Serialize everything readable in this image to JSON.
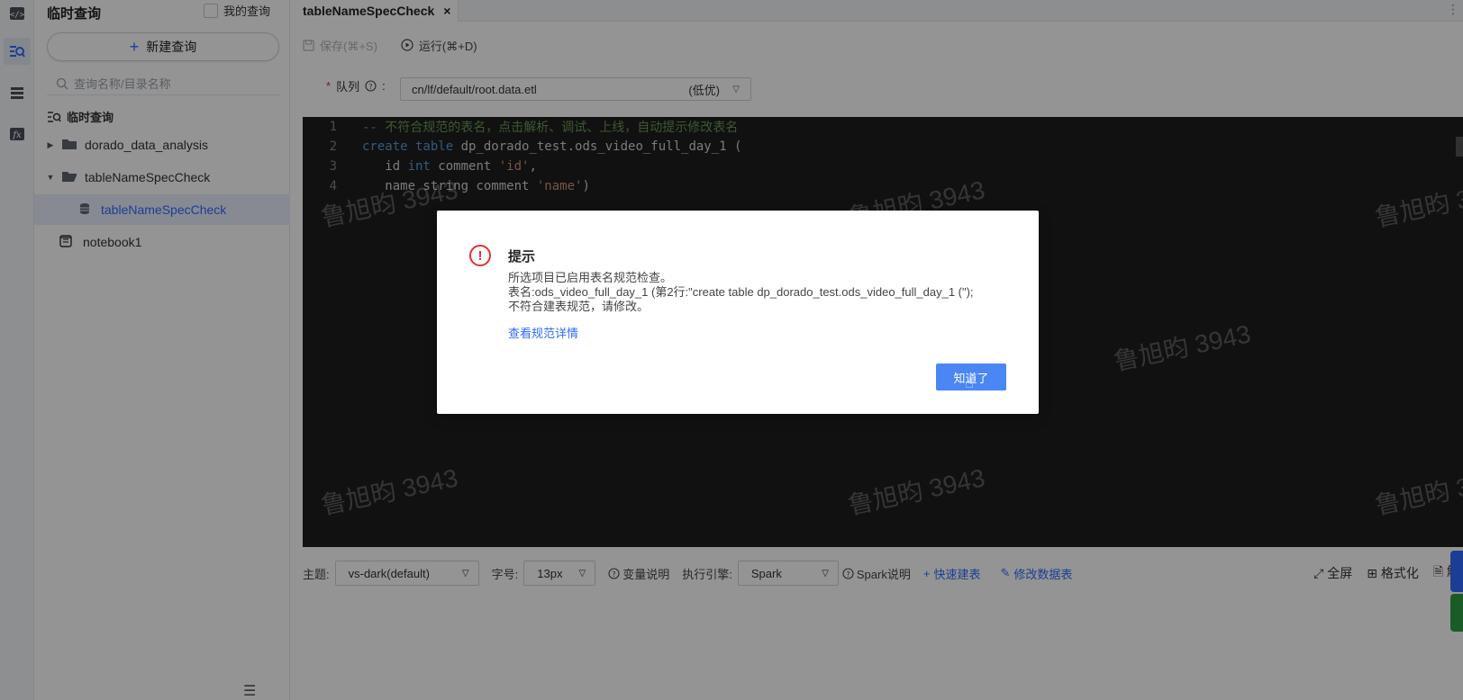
{
  "sidebar": {
    "title": "临时查询",
    "my_queries": "我的查询",
    "new_query": "新建查询",
    "search_placeholder": "查询名称/目录名称",
    "tree_root": "临时查询",
    "tree": [
      {
        "label": "dorado_data_analysis",
        "type": "folder",
        "expanded": false
      },
      {
        "label": "tableNameSpecCheck",
        "type": "folder",
        "expanded": true
      },
      {
        "label": "tableNameSpecCheck",
        "type": "query",
        "active": true
      },
      {
        "label": "notebook1",
        "type": "notebook"
      }
    ]
  },
  "tab": {
    "label": "tableNameSpecCheck",
    "close": "×"
  },
  "toolbar": {
    "save": "保存(⌘+S)",
    "run": "运行(⌘+D)"
  },
  "queue": {
    "label": "队列",
    "required": "*",
    "value": "cn/lf/default/root.data.etl",
    "priority": "(低优)"
  },
  "editor": {
    "lines": [
      {
        "n": "1",
        "comment": "-- 不符合规范的表名，点击解析、调试、上线，自动提示修改表名"
      },
      {
        "n": "2",
        "kw1": "create table ",
        "id1": "dp_dorado_test.ods_video_full_day_1 ("
      },
      {
        "n": "3",
        "id1": "   id ",
        "kw1": "int",
        "id2": " comment ",
        "str1": "'id'",
        "id3": ","
      },
      {
        "n": "4",
        "id1": "   name string comment ",
        "str1": "'name'",
        "id2": ")"
      }
    ]
  },
  "bottom": {
    "theme_label": "主题:",
    "theme_value": "vs-dark(default)",
    "font_label": "字号:",
    "font_value": "13px",
    "var_help": "变量说明",
    "engine_label": "执行引擎:",
    "engine_value": "Spark",
    "spark_help": "Spark说明",
    "quick_create": "快速建表",
    "modify_table": "修改数据表",
    "fullscreen": "全屏",
    "format": "格式化",
    "parse": "解"
  },
  "dialog": {
    "title": "提示",
    "line1": "所选项目已启用表名规范检查。",
    "line2": "表名:ods_video_full_day_1   (第2行:\"create table dp_dorado_test.ods_video_full_day_1 (\");",
    "line3": "不符合建表规范，请修改。",
    "link": "查看规范详情",
    "ok": "知道了"
  },
  "watermark": "鲁旭昀 3943",
  "colors": {
    "accent": "#2f6bff",
    "error": "#e03131",
    "editor_bg": "#1e1e1e"
  }
}
